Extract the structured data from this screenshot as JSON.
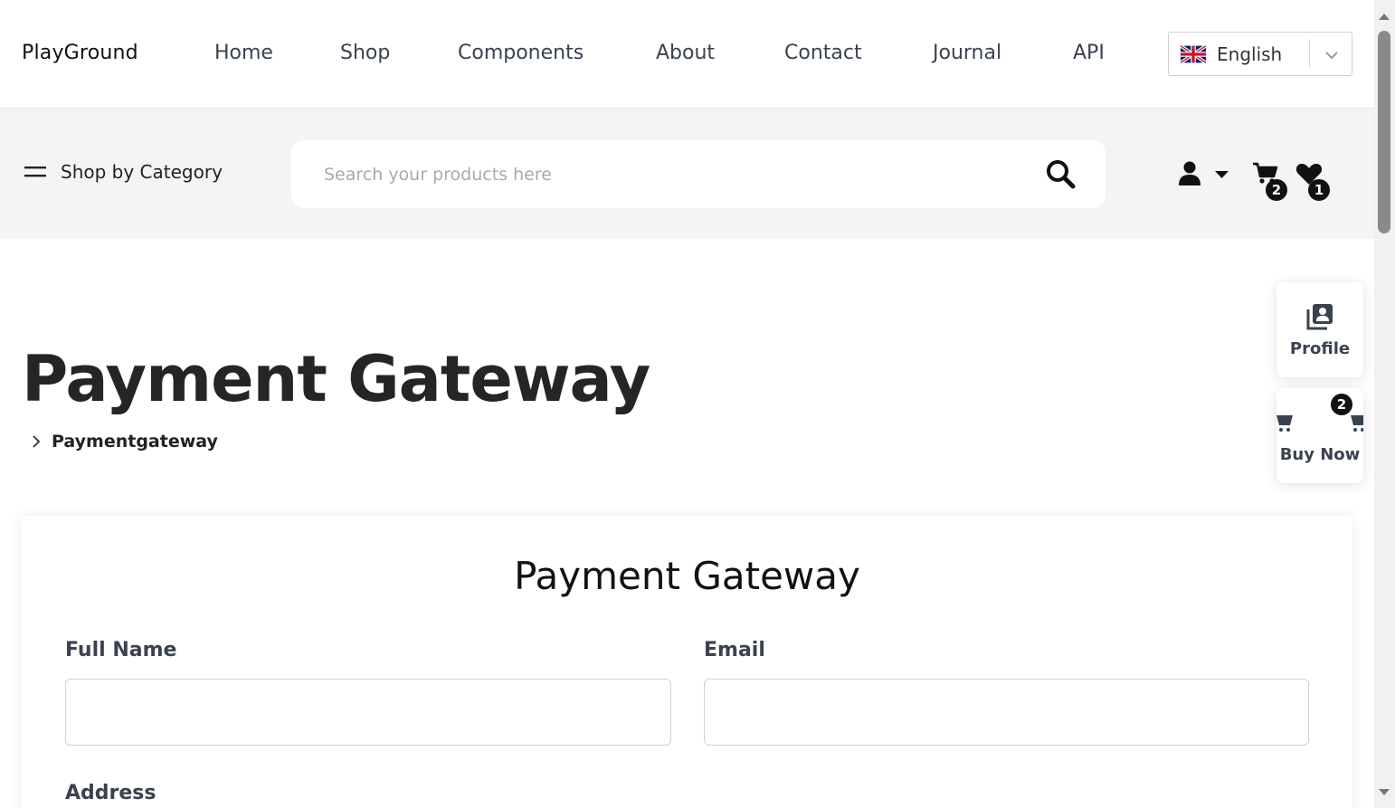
{
  "header": {
    "brand": "PlayGround",
    "nav": [
      {
        "label": "Home"
      },
      {
        "label": "Shop"
      },
      {
        "label": "Components"
      },
      {
        "label": "About"
      },
      {
        "label": "Contact"
      },
      {
        "label": "Journal"
      },
      {
        "label": "API"
      }
    ],
    "language": {
      "label": "English",
      "flag_icon": "uk-flag-icon"
    }
  },
  "subbar": {
    "category_label": "Shop by Category",
    "search": {
      "placeholder": "Search your products here",
      "value": ""
    },
    "cart_count": "2",
    "wishlist_count": "1"
  },
  "page": {
    "title": "Payment Gateway",
    "breadcrumb": "Paymentgateway"
  },
  "floating": {
    "profile_label": "Profile",
    "buy_label": "Buy Now",
    "buy_count": "2"
  },
  "form": {
    "title": "Payment Gateway",
    "full_name_label": "Full Name",
    "full_name_value": "",
    "email_label": "Email",
    "email_value": "",
    "address_label": "Address"
  },
  "colors": {
    "subbar_bg": "#f4f4f3",
    "text_dark": "#252525",
    "nav_text": "#3a4250"
  }
}
